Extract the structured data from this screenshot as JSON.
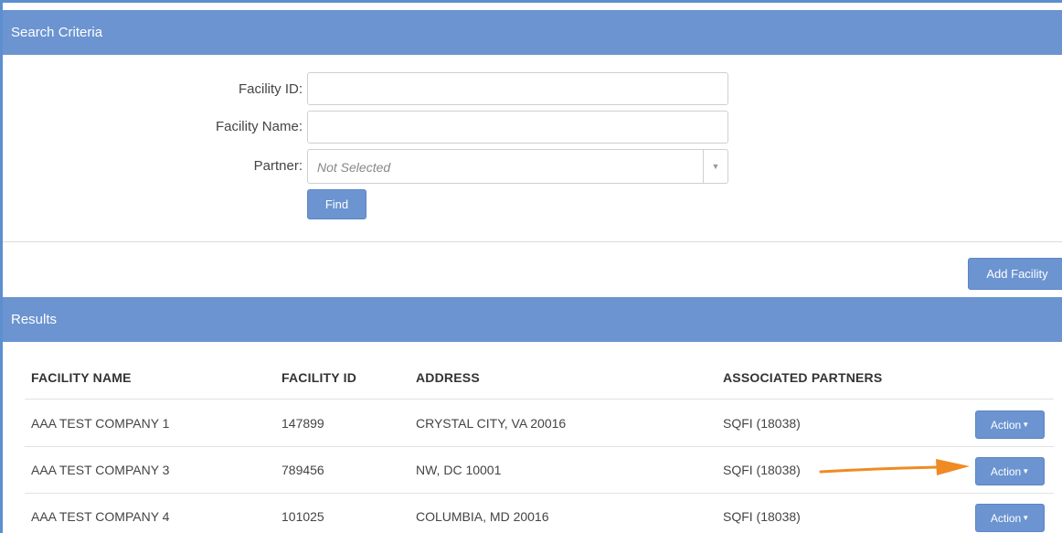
{
  "search": {
    "header": "Search Criteria",
    "facility_id_label": "Facility ID:",
    "facility_id_value": "",
    "facility_name_label": "Facility Name:",
    "facility_name_value": "",
    "partner_label": "Partner:",
    "partner_placeholder": "Not Selected",
    "find_label": "Find"
  },
  "toolbar": {
    "add_facility_label": "Add Facility"
  },
  "results": {
    "header": "Results",
    "columns": [
      "FACILITY NAME",
      "FACILITY ID",
      "ADDRESS",
      "ASSOCIATED PARTNERS"
    ],
    "rows": [
      {
        "name": "AAA TEST COMPANY 1",
        "id": "147899",
        "address": "CRYSTAL CITY, VA 20016",
        "partners": "SQFI (18038)",
        "action": "Action"
      },
      {
        "name": "AAA TEST COMPANY 3",
        "id": "789456",
        "address": "NW, DC 10001",
        "partners": "SQFI (18038)",
        "action": "Action"
      },
      {
        "name": "AAA TEST COMPANY 4",
        "id": "101025",
        "address": "COLUMBIA, MD 20016",
        "partners": "SQFI (18038)",
        "action": "Action"
      }
    ]
  },
  "colors": {
    "header_blue": "#6b94d0",
    "annotation_arrow": "#f08a24"
  }
}
